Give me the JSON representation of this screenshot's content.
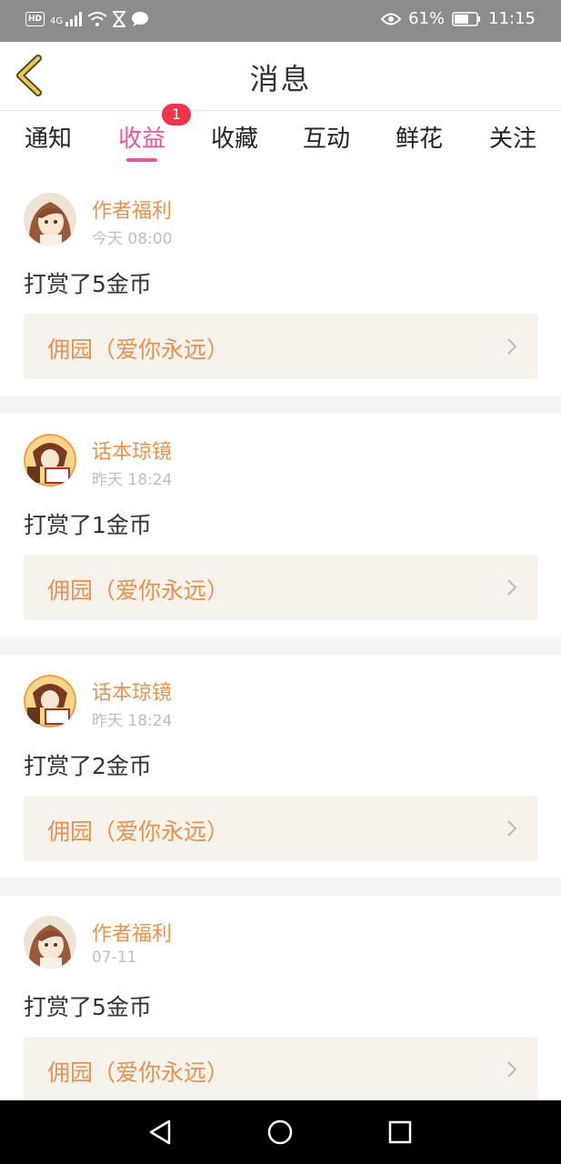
{
  "status_bar": {
    "hd_label": "HD",
    "signal_label": "4G",
    "battery_percent": "61%",
    "time": "11:15",
    "icons": [
      "hd-icon",
      "signal-icon",
      "wifi-icon",
      "hourglass-icon",
      "chat-bubble-icon",
      "eye-icon",
      "battery-icon"
    ]
  },
  "header": {
    "title": "消息",
    "back_icon": "back-chevron-icon",
    "accent_color": "#f0c94a"
  },
  "tabs": [
    {
      "label": "通知",
      "active": false
    },
    {
      "label": "收益",
      "active": true,
      "badge": "1"
    },
    {
      "label": "收藏",
      "active": false
    },
    {
      "label": "互动",
      "active": false
    },
    {
      "label": "鲜花",
      "active": false
    },
    {
      "label": "关注",
      "active": false
    }
  ],
  "active_color": "#e8559a",
  "messages": [
    {
      "sender": "作者福利",
      "time": "今天 08:00",
      "text": "打赏了5金币",
      "link": "佣园（爱你永远）",
      "avatar": "anime-girl-avatar"
    },
    {
      "sender": "话本琼镜",
      "time": "昨天 18:24",
      "text": "打赏了1金币",
      "link": "佣园（爱你永远）",
      "avatar": "manga-avatar"
    },
    {
      "sender": "话本琼镜",
      "time": "昨天 18:24",
      "text": "打赏了2金币",
      "link": "佣园（爱你永远）",
      "avatar": "manga-avatar"
    },
    {
      "sender": "作者福利",
      "time": "07-11",
      "text": "打赏了5金币",
      "link": "佣园（爱你永远）",
      "avatar": "anime-girl-avatar"
    }
  ],
  "system_nav": [
    "back-triangle-icon",
    "home-circle-icon",
    "recents-square-icon"
  ]
}
